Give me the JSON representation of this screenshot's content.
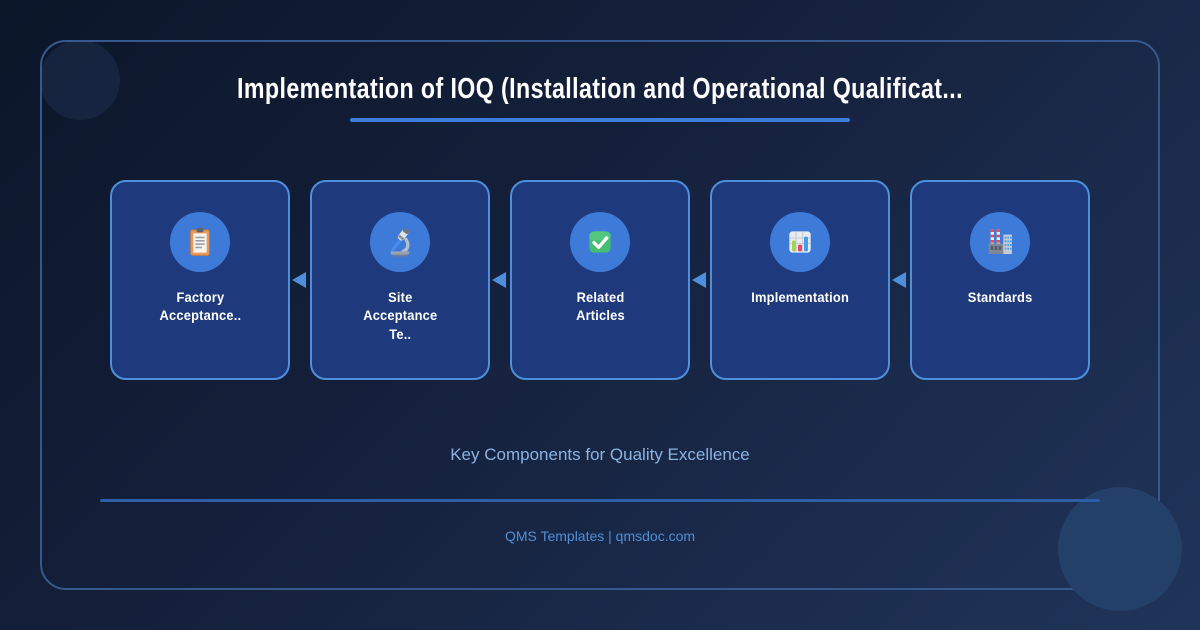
{
  "page": {
    "title": "Implementation of IOQ (Installation and Operational Qualificat...",
    "subtitle": "Key Components for Quality Excellence",
    "footer": "QMS Templates | qmsdoc.com"
  },
  "cards": [
    {
      "label": "Factory\nAcceptance..",
      "icon": "clipboard-icon"
    },
    {
      "label": "Site\nAcceptance\nTe..",
      "icon": "microscope-icon"
    },
    {
      "label": "Related\nArticles",
      "icon": "check-mark-icon"
    },
    {
      "label": "Implementation",
      "icon": "bar-chart-icon"
    },
    {
      "label": "Standards",
      "icon": "factory-icon"
    }
  ],
  "arrows": {
    "count": 4,
    "direction": "left"
  },
  "colors": {
    "frame_border": "#35598f",
    "card_bg": "#1e3a7d",
    "card_border": "#4e8fdd",
    "icon_circle": "#3e7ad8",
    "arrow": "#4e8fdd",
    "title_underline": "#3d7cd9",
    "divider": "#2d5ea6",
    "subtitle_text": "#8ab3e3",
    "footer_text": "#4e8fd9",
    "title_text": "#ffffff",
    "card_label_text": "#ffffff"
  }
}
